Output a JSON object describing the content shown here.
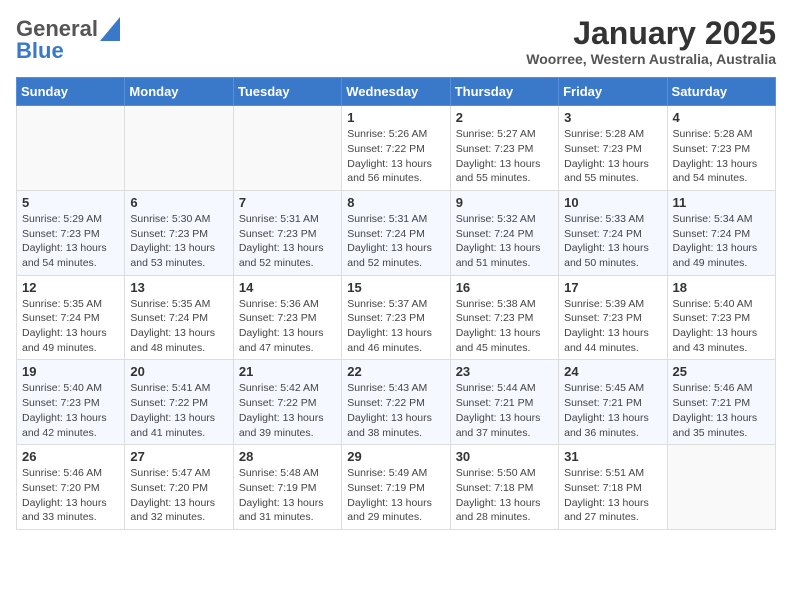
{
  "header": {
    "logo_general": "General",
    "logo_blue": "Blue",
    "month_title": "January 2025",
    "location": "Woorree, Western Australia, Australia"
  },
  "calendar": {
    "days_of_week": [
      "Sunday",
      "Monday",
      "Tuesday",
      "Wednesday",
      "Thursday",
      "Friday",
      "Saturday"
    ],
    "weeks": [
      [
        {
          "day": "",
          "info": ""
        },
        {
          "day": "",
          "info": ""
        },
        {
          "day": "",
          "info": ""
        },
        {
          "day": "1",
          "info": "Sunrise: 5:26 AM\nSunset: 7:22 PM\nDaylight: 13 hours\nand 56 minutes."
        },
        {
          "day": "2",
          "info": "Sunrise: 5:27 AM\nSunset: 7:23 PM\nDaylight: 13 hours\nand 55 minutes."
        },
        {
          "day": "3",
          "info": "Sunrise: 5:28 AM\nSunset: 7:23 PM\nDaylight: 13 hours\nand 55 minutes."
        },
        {
          "day": "4",
          "info": "Sunrise: 5:28 AM\nSunset: 7:23 PM\nDaylight: 13 hours\nand 54 minutes."
        }
      ],
      [
        {
          "day": "5",
          "info": "Sunrise: 5:29 AM\nSunset: 7:23 PM\nDaylight: 13 hours\nand 54 minutes."
        },
        {
          "day": "6",
          "info": "Sunrise: 5:30 AM\nSunset: 7:23 PM\nDaylight: 13 hours\nand 53 minutes."
        },
        {
          "day": "7",
          "info": "Sunrise: 5:31 AM\nSunset: 7:23 PM\nDaylight: 13 hours\nand 52 minutes."
        },
        {
          "day": "8",
          "info": "Sunrise: 5:31 AM\nSunset: 7:24 PM\nDaylight: 13 hours\nand 52 minutes."
        },
        {
          "day": "9",
          "info": "Sunrise: 5:32 AM\nSunset: 7:24 PM\nDaylight: 13 hours\nand 51 minutes."
        },
        {
          "day": "10",
          "info": "Sunrise: 5:33 AM\nSunset: 7:24 PM\nDaylight: 13 hours\nand 50 minutes."
        },
        {
          "day": "11",
          "info": "Sunrise: 5:34 AM\nSunset: 7:24 PM\nDaylight: 13 hours\nand 49 minutes."
        }
      ],
      [
        {
          "day": "12",
          "info": "Sunrise: 5:35 AM\nSunset: 7:24 PM\nDaylight: 13 hours\nand 49 minutes."
        },
        {
          "day": "13",
          "info": "Sunrise: 5:35 AM\nSunset: 7:24 PM\nDaylight: 13 hours\nand 48 minutes."
        },
        {
          "day": "14",
          "info": "Sunrise: 5:36 AM\nSunset: 7:23 PM\nDaylight: 13 hours\nand 47 minutes."
        },
        {
          "day": "15",
          "info": "Sunrise: 5:37 AM\nSunset: 7:23 PM\nDaylight: 13 hours\nand 46 minutes."
        },
        {
          "day": "16",
          "info": "Sunrise: 5:38 AM\nSunset: 7:23 PM\nDaylight: 13 hours\nand 45 minutes."
        },
        {
          "day": "17",
          "info": "Sunrise: 5:39 AM\nSunset: 7:23 PM\nDaylight: 13 hours\nand 44 minutes."
        },
        {
          "day": "18",
          "info": "Sunrise: 5:40 AM\nSunset: 7:23 PM\nDaylight: 13 hours\nand 43 minutes."
        }
      ],
      [
        {
          "day": "19",
          "info": "Sunrise: 5:40 AM\nSunset: 7:23 PM\nDaylight: 13 hours\nand 42 minutes."
        },
        {
          "day": "20",
          "info": "Sunrise: 5:41 AM\nSunset: 7:22 PM\nDaylight: 13 hours\nand 41 minutes."
        },
        {
          "day": "21",
          "info": "Sunrise: 5:42 AM\nSunset: 7:22 PM\nDaylight: 13 hours\nand 39 minutes."
        },
        {
          "day": "22",
          "info": "Sunrise: 5:43 AM\nSunset: 7:22 PM\nDaylight: 13 hours\nand 38 minutes."
        },
        {
          "day": "23",
          "info": "Sunrise: 5:44 AM\nSunset: 7:21 PM\nDaylight: 13 hours\nand 37 minutes."
        },
        {
          "day": "24",
          "info": "Sunrise: 5:45 AM\nSunset: 7:21 PM\nDaylight: 13 hours\nand 36 minutes."
        },
        {
          "day": "25",
          "info": "Sunrise: 5:46 AM\nSunset: 7:21 PM\nDaylight: 13 hours\nand 35 minutes."
        }
      ],
      [
        {
          "day": "26",
          "info": "Sunrise: 5:46 AM\nSunset: 7:20 PM\nDaylight: 13 hours\nand 33 minutes."
        },
        {
          "day": "27",
          "info": "Sunrise: 5:47 AM\nSunset: 7:20 PM\nDaylight: 13 hours\nand 32 minutes."
        },
        {
          "day": "28",
          "info": "Sunrise: 5:48 AM\nSunset: 7:19 PM\nDaylight: 13 hours\nand 31 minutes."
        },
        {
          "day": "29",
          "info": "Sunrise: 5:49 AM\nSunset: 7:19 PM\nDaylight: 13 hours\nand 29 minutes."
        },
        {
          "day": "30",
          "info": "Sunrise: 5:50 AM\nSunset: 7:18 PM\nDaylight: 13 hours\nand 28 minutes."
        },
        {
          "day": "31",
          "info": "Sunrise: 5:51 AM\nSunset: 7:18 PM\nDaylight: 13 hours\nand 27 minutes."
        },
        {
          "day": "",
          "info": ""
        }
      ]
    ]
  }
}
